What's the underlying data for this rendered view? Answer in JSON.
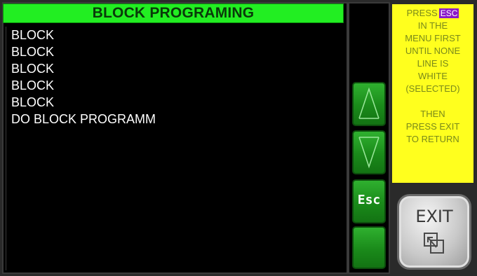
{
  "title": "BLOCK PROGRAMING",
  "list": {
    "items": [
      {
        "label": "BLOCK"
      },
      {
        "label": "BLOCK"
      },
      {
        "label": "BLOCK"
      },
      {
        "label": "BLOCK"
      },
      {
        "label": "BLOCK"
      },
      {
        "label": "DO BLOCK PROGRAMM"
      }
    ]
  },
  "buttons": {
    "up": "up-arrow-icon",
    "down": "down-arrow-icon",
    "esc_label": "Esc",
    "blank": "",
    "exit_label": "EXIT",
    "exit_icon": "exit-window-icon"
  },
  "info": {
    "press": "PRESS",
    "esc": "ESC",
    "line2": "IN THE",
    "line3": "MENU FIRST",
    "line4": "UNTIL NONE",
    "line5": "LINE IS",
    "line6": "WHITE",
    "line7": "(SELECTED)",
    "line8": "THEN",
    "line9": "PRESS EXIT",
    "line10": "TO RETURN"
  },
  "colors": {
    "title_bg": "#22ee22",
    "button_green": "#1a8a1a",
    "info_bg": "#ffff1e",
    "esc_badge": "#8a1ac8",
    "text_white": "#ffffff"
  }
}
